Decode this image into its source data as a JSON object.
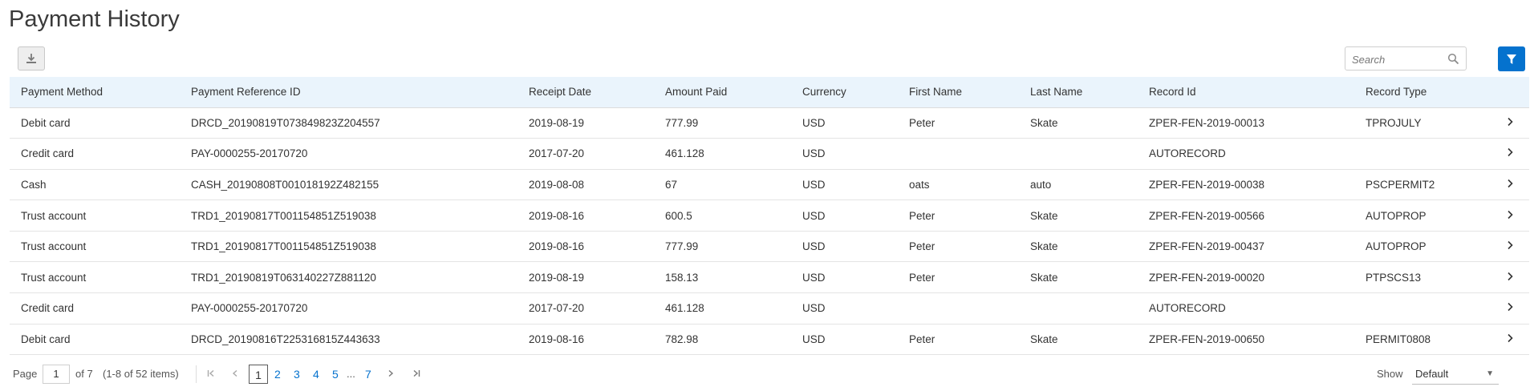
{
  "page": {
    "title": "Payment History"
  },
  "toolbar": {
    "download_icon": "download-icon",
    "search_placeholder": "Search",
    "search_value": "",
    "search_icon": "search-icon",
    "filter_icon": "filter-icon",
    "accent_color": "#0572ce"
  },
  "table": {
    "header_bg": "#eaf4fc",
    "columns": [
      "Payment Method",
      "Payment Reference ID",
      "Receipt Date",
      "Amount Paid",
      "Currency",
      "First Name",
      "Last Name",
      "Record Id",
      "Record Type"
    ],
    "rows": [
      [
        "Debit card",
        "DRCD_20190819T073849823Z204557",
        "2019-08-19",
        "777.99",
        "USD",
        "Peter",
        "Skate",
        "ZPER-FEN-2019-00013",
        "TPROJULY"
      ],
      [
        "Credit card",
        "PAY-0000255-20170720",
        "2017-07-20",
        "461.128",
        "USD",
        "",
        "",
        "AUTORECORD",
        ""
      ],
      [
        "Cash",
        "CASH_20190808T001018192Z482155",
        "2019-08-08",
        "67",
        "USD",
        "oats",
        "auto",
        "ZPER-FEN-2019-00038",
        "PSCPERMIT2"
      ],
      [
        "Trust account",
        "TRD1_20190817T001154851Z519038",
        "2019-08-16",
        "600.5",
        "USD",
        "Peter",
        "Skate",
        "ZPER-FEN-2019-00566",
        "AUTOPROP"
      ],
      [
        "Trust account",
        "TRD1_20190817T001154851Z519038",
        "2019-08-16",
        "777.99",
        "USD",
        "Peter",
        "Skate",
        "ZPER-FEN-2019-00437",
        "AUTOPROP"
      ],
      [
        "Trust account",
        "TRD1_20190819T063140227Z881120",
        "2019-08-19",
        "158.13",
        "USD",
        "Peter",
        "Skate",
        "ZPER-FEN-2019-00020",
        "PTPSCS13"
      ],
      [
        "Credit card",
        "PAY-0000255-20170720",
        "2017-07-20",
        "461.128",
        "USD",
        "",
        "",
        "AUTORECORD",
        ""
      ],
      [
        "Debit card",
        "DRCD_20190816T225316815Z443633",
        "2019-08-16",
        "782.98",
        "USD",
        "Peter",
        "Skate",
        "ZPER-FEN-2019-00650",
        "PERMIT0808"
      ]
    ],
    "row_action_icon": "chevron-right-icon"
  },
  "pagination": {
    "page_label": "Page",
    "current_page": "1",
    "of_label": "of 7",
    "items_label": "(1-8 of 52 items)",
    "first_icon": "first-page-icon",
    "prev_icon": "previous-page-icon",
    "pages": [
      "1",
      "2",
      "3",
      "4",
      "5"
    ],
    "ellipsis": "...",
    "last_page": "7",
    "next_icon": "next-page-icon",
    "last_icon": "last-page-icon",
    "show_label": "Show",
    "show_value": "Default"
  }
}
